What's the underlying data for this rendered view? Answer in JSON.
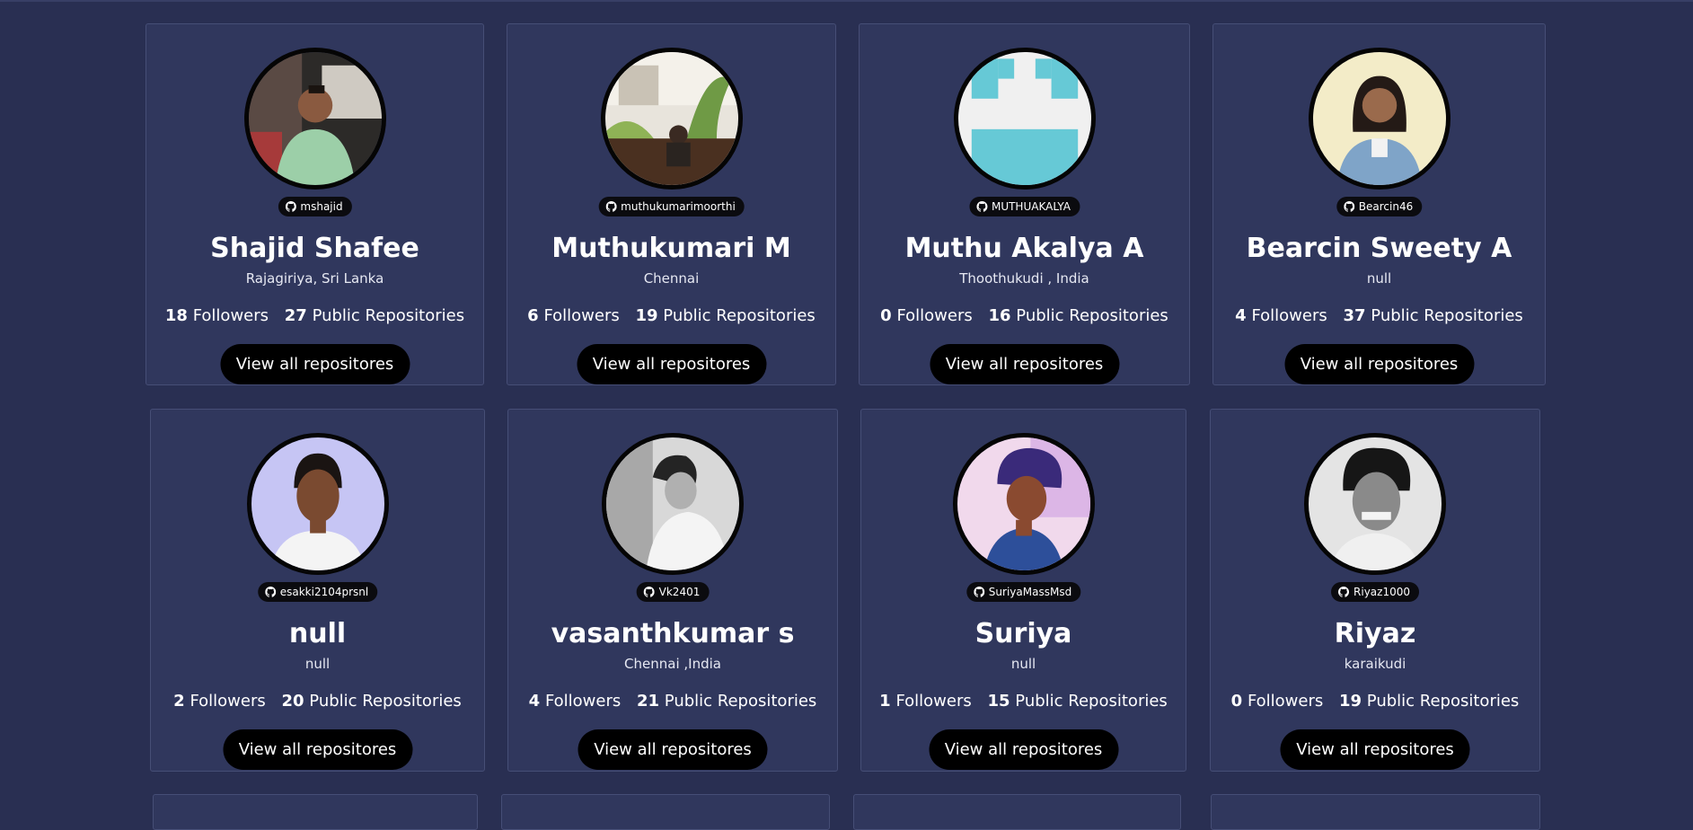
{
  "cards": [
    {
      "handle": "mshajid",
      "name": "Shajid Shafee",
      "location": "Rajagiriya, Sri Lanka",
      "followers": "18",
      "followers_label": "Followers",
      "repos": "27",
      "repos_label": "Public Repositories",
      "button": "View all repositores"
    },
    {
      "handle": "muthukumarimoorthi",
      "name": "Muthukumari M",
      "location": "Chennai",
      "followers": "6",
      "followers_label": "Followers",
      "repos": "19",
      "repos_label": "Public Repositories",
      "button": "View all repositores"
    },
    {
      "handle": "MUTHUAKALYA",
      "name": "Muthu Akalya A",
      "location": "Thoothukudi , India",
      "followers": "0",
      "followers_label": "Followers",
      "repos": "16",
      "repos_label": "Public Repositories",
      "button": "View all repositores"
    },
    {
      "handle": "Bearcin46",
      "name": "Bearcin Sweety A",
      "location": "null",
      "followers": "4",
      "followers_label": "Followers",
      "repos": "37",
      "repos_label": "Public Repositories",
      "button": "View all repositores"
    },
    {
      "handle": "esakki2104prsnl",
      "name": "null",
      "location": "null",
      "followers": "2",
      "followers_label": "Followers",
      "repos": "20",
      "repos_label": "Public Repositories",
      "button": "View all repositores"
    },
    {
      "handle": "Vk2401",
      "name": "vasanthkumar s",
      "location": "Chennai ,India",
      "followers": "4",
      "followers_label": "Followers",
      "repos": "21",
      "repos_label": "Public Repositories",
      "button": "View all repositores"
    },
    {
      "handle": "SuriyaMassMsd",
      "name": "Suriya",
      "location": "null",
      "followers": "1",
      "followers_label": "Followers",
      "repos": "15",
      "repos_label": "Public Repositories",
      "button": "View all repositores"
    },
    {
      "handle": "Riyaz1000",
      "name": "Riyaz",
      "location": "karaikudi",
      "followers": "0",
      "followers_label": "Followers",
      "repos": "19",
      "repos_label": "Public Repositories",
      "button": "View all repositores"
    }
  ],
  "icons": {
    "badge": "github-icon"
  },
  "colors": {
    "background": "#292f52",
    "card": "#30375d",
    "button": "#000000"
  }
}
